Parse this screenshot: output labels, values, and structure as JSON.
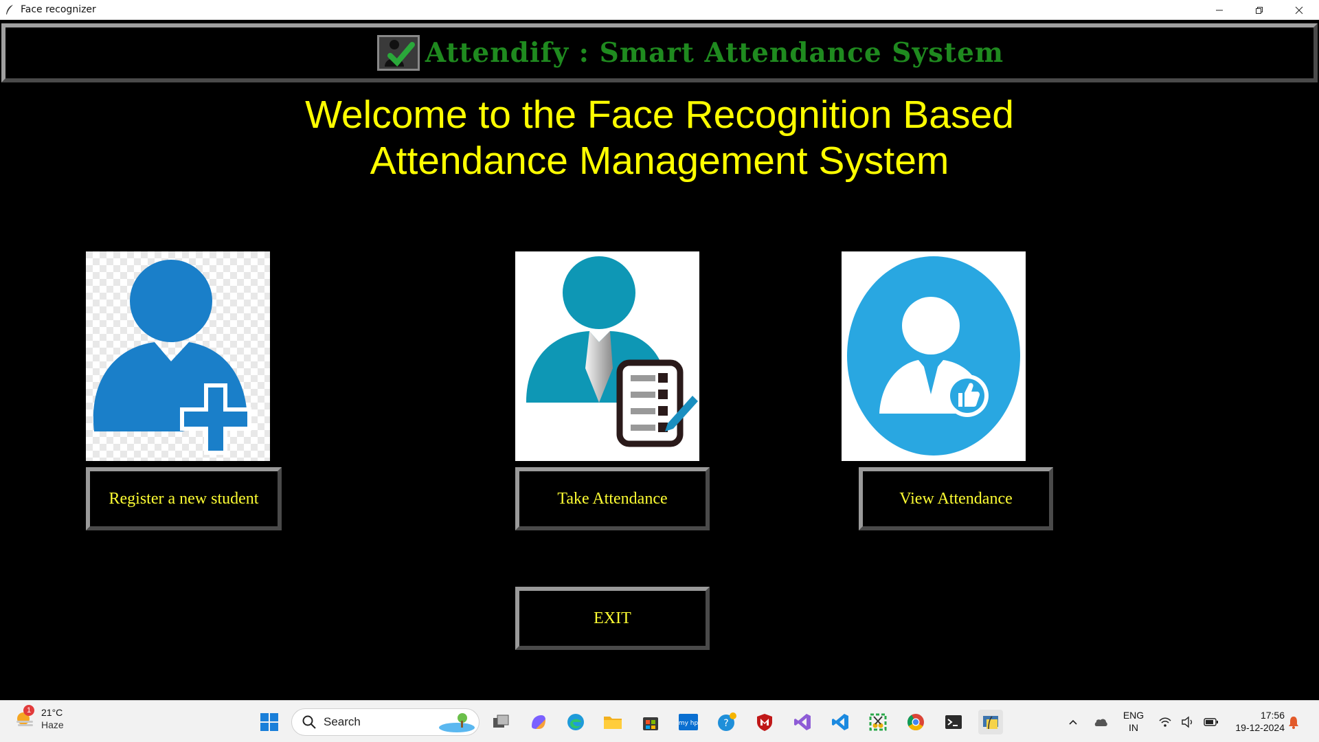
{
  "window": {
    "title": "Face recognizer"
  },
  "header": {
    "app_title": "Attendify : Smart Attendance System"
  },
  "welcome": {
    "line1": "Welcome to the Face Recognition Based",
    "line2": "Attendance Management System"
  },
  "buttons": {
    "register": "Register a new student",
    "take": "Take Attendance",
    "view": "View Attendance",
    "exit": "EXIT"
  },
  "taskbar": {
    "weather_temp": "21°C",
    "weather_cond": "Haze",
    "weather_badge": "1",
    "search_label": "Search",
    "lang_top": "ENG",
    "lang_bottom": "IN",
    "time": "17:56",
    "date": "19-12-2024"
  },
  "colors": {
    "heading_green": "#1f8a1f",
    "welcome_yellow": "#ffff00",
    "button_text": "#ffff33",
    "icon_blue": "#1a7fc9",
    "icon_teal": "#0e97b5",
    "icon_sky": "#29a7e1"
  },
  "icons": {
    "tile_register": "person-add-icon",
    "tile_take": "person-clipboard-icon",
    "tile_view": "person-thumbsup-icon"
  }
}
